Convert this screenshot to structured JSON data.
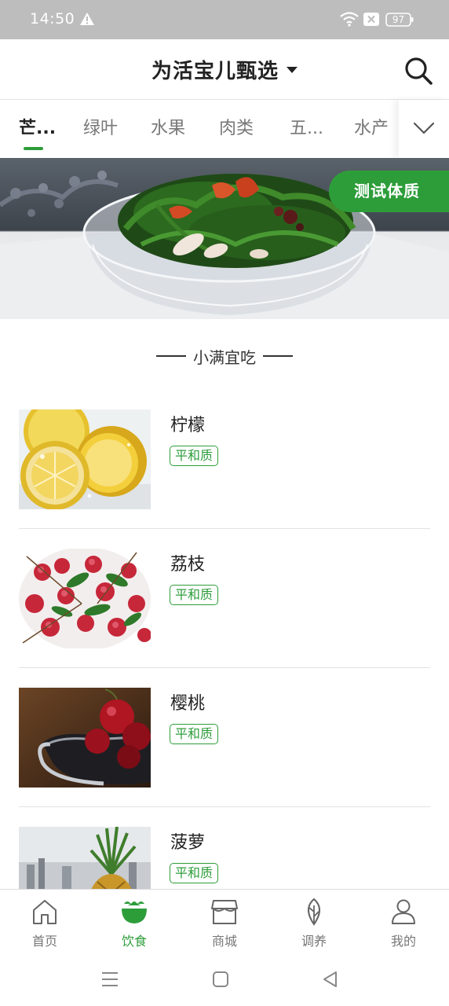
{
  "status_bar": {
    "time": "14:50",
    "battery": "97",
    "icons": [
      "warning-icon",
      "wifi-icon",
      "sim-off-icon",
      "battery-icon"
    ]
  },
  "header": {
    "title": "为活宝儿甄选",
    "icons": [
      "caret-down-icon",
      "search-icon"
    ]
  },
  "tabs": {
    "items": [
      {
        "label": "芒..."
      },
      {
        "label": "绿叶"
      },
      {
        "label": "水果"
      },
      {
        "label": "肉类"
      },
      {
        "label": "五..."
      },
      {
        "label": "水产"
      }
    ],
    "active_index": 0,
    "expand_icon": "chevron-down-icon"
  },
  "banner": {
    "button_label": "测试体质"
  },
  "section": {
    "title": "小满宜吃"
  },
  "foods": [
    {
      "name": "柠檬",
      "tag": "平和质"
    },
    {
      "name": "荔枝",
      "tag": "平和质"
    },
    {
      "name": "樱桃",
      "tag": "平和质"
    },
    {
      "name": "菠萝",
      "tag": "平和质"
    }
  ],
  "bottom_nav": {
    "items": [
      {
        "label": "首页",
        "icon": "home-icon"
      },
      {
        "label": "饮食",
        "icon": "bowl-icon"
      },
      {
        "label": "商城",
        "icon": "store-icon"
      },
      {
        "label": "调养",
        "icon": "leaf-icon"
      },
      {
        "label": "我的",
        "icon": "user-icon"
      }
    ],
    "active_index": 1
  },
  "system_nav": {
    "icons": [
      "menu-icon",
      "home-square-icon",
      "back-triangle-icon"
    ]
  },
  "colors": {
    "accent": "#2d9d3a",
    "status_bar": "#bdbdbd"
  }
}
